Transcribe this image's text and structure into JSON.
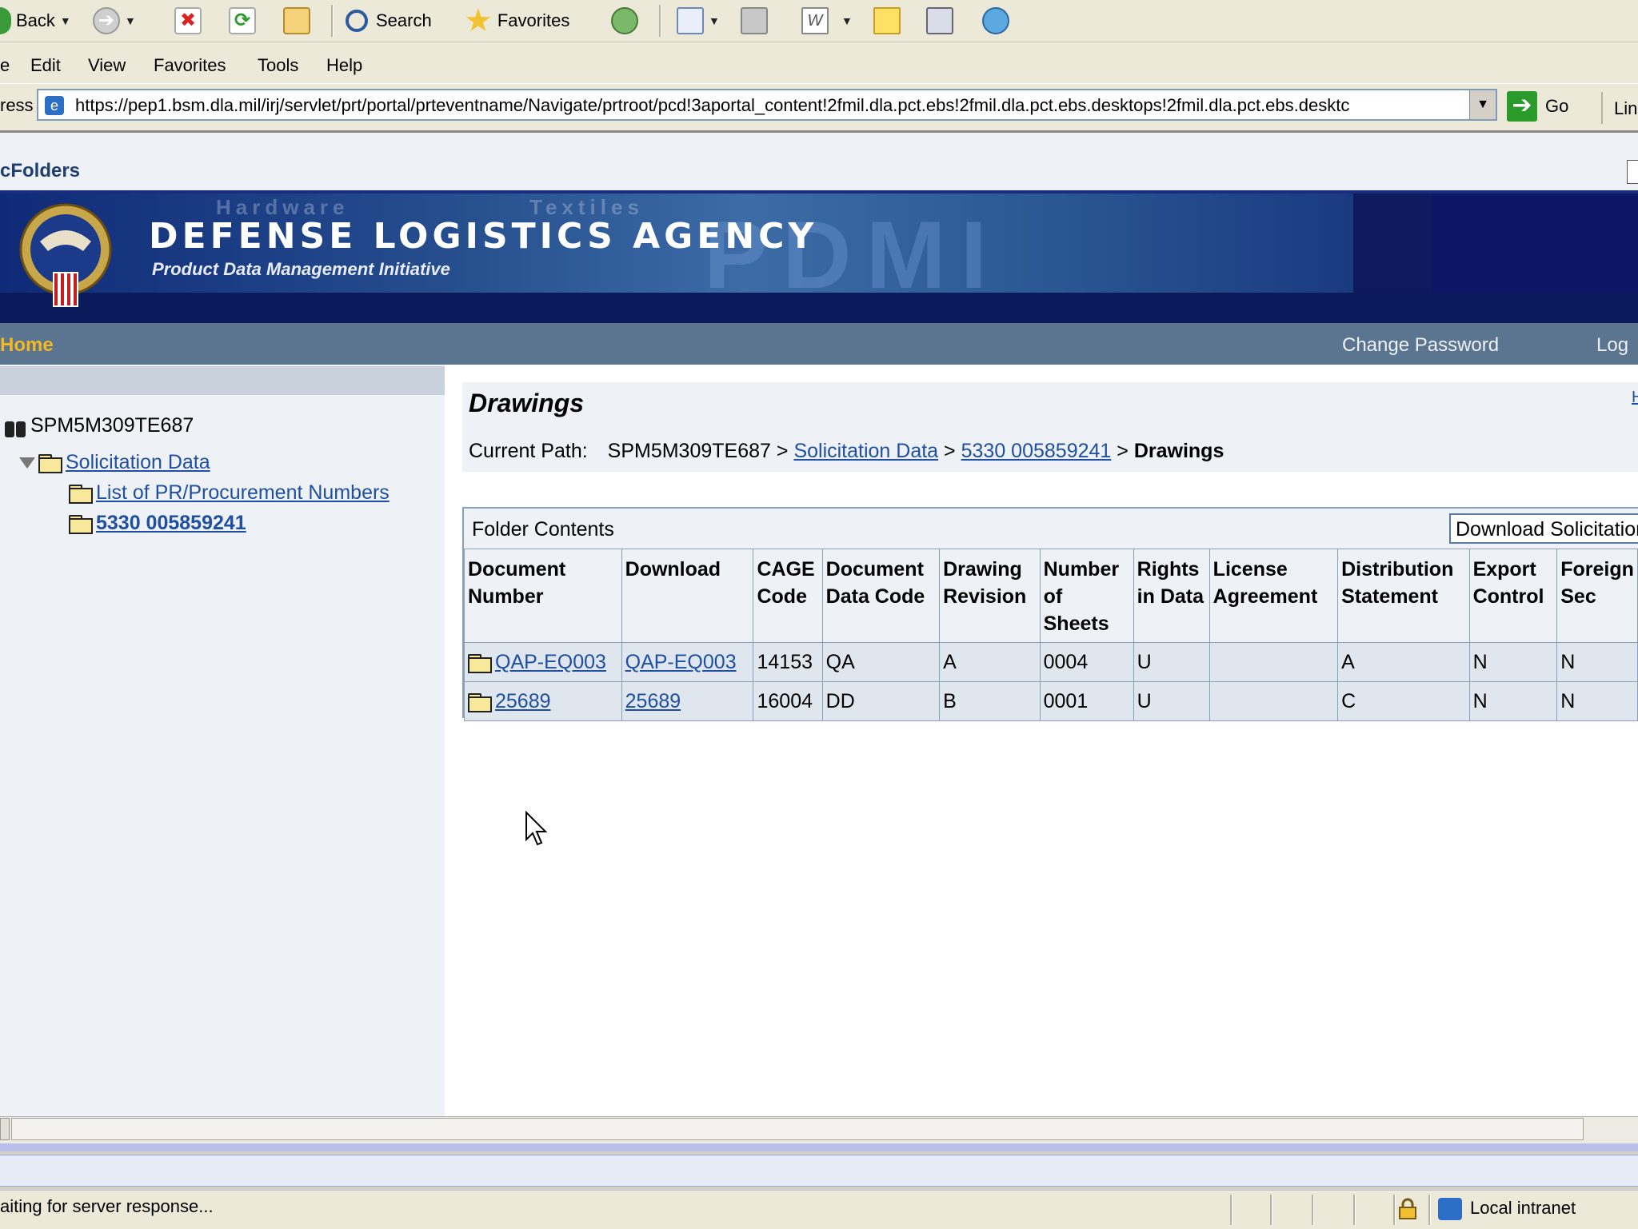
{
  "toolbar": {
    "back_label": "Back",
    "search_label": "Search",
    "favorites_label": "Favorites"
  },
  "menu": {
    "file": "e",
    "edit": "Edit",
    "view": "View",
    "favorites": "Favorites",
    "tools": "Tools",
    "help": "Help"
  },
  "address": {
    "label": "ress",
    "url": "https://pep1.bsm.dla.mil/irj/servlet/prt/portal/prteventname/Navigate/prtroot/pcd!3aportal_content!2fmil.dla.pct.ebs!2fmil.dla.pct.ebs.desktops!2fmil.dla.pct.ebs.desktc",
    "go_label": "Go",
    "links_label": "Lin"
  },
  "portal": {
    "title": "cFolders"
  },
  "banner": {
    "agency": "DEFENSE LOGISTICS AGENCY",
    "initiative": "Product Data Management Initiative",
    "bg_word_1": "Hardware",
    "bg_word_2": "Textiles",
    "bg_word_3": "PDMI"
  },
  "nav": {
    "home": "Home",
    "change_password": "Change Password",
    "logoff": "Log"
  },
  "tree": {
    "root": "SPM5M309TE687",
    "solicitation": "Solicitation Data",
    "pr_list": "List of PR/Procurement Numbers",
    "current": "5330 005859241"
  },
  "main": {
    "title": "Drawings",
    "title_right": "H",
    "path_label": "Current Path:",
    "path_root": "SPM5M309TE687",
    "path_sep": ">",
    "path_link1": "Solicitation Data",
    "path_link2": "5330 005859241",
    "path_current": "Drawings",
    "folder_contents": "Folder Contents",
    "download_button": "Download Solicitation"
  },
  "table": {
    "headers": [
      "Document Number",
      "Download",
      "CAGE Code",
      "Document Data Code",
      "Drawing Revision",
      "Number of Sheets",
      "Rights in Data",
      "License Agreement",
      "Distribution Statement",
      "Export Control",
      "Foreign Sec"
    ],
    "rows": [
      [
        "QAP-EQ003",
        "QAP-EQ003",
        "14153",
        "QA",
        "A",
        "0004",
        "U",
        "",
        "A",
        "N",
        "N"
      ],
      [
        "25689",
        "25689",
        "16004",
        "DD",
        "B",
        "0001",
        "U",
        "",
        "C",
        "N",
        "N"
      ]
    ]
  },
  "status": {
    "text": "aiting for server response...",
    "zone": "Local intranet"
  },
  "colors": {
    "link": "#1f4fa0",
    "nav_bg": "#5b7590",
    "home_accent": "#f5b820",
    "banner_bg": "#0e1a5e"
  }
}
